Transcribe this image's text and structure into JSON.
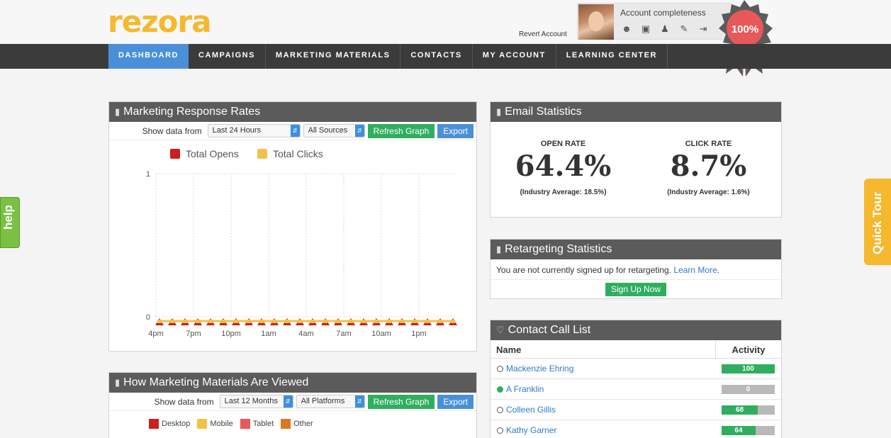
{
  "brand": {
    "logo": "rezora"
  },
  "header": {
    "revert_account": "Revert Account",
    "account_completeness": "Account completeness",
    "completeness_badge": "100%",
    "icons": [
      "user-icon",
      "id-card-icon",
      "people-icon",
      "pencil-icon",
      "import-icon"
    ]
  },
  "nav": {
    "items": [
      {
        "label": "DASHBOARD",
        "active": true
      },
      {
        "label": "CAMPAIGNS",
        "active": false
      },
      {
        "label": "MARKETING MATERIALS",
        "active": false
      },
      {
        "label": "CONTACTS",
        "active": false
      },
      {
        "label": "MY ACCOUNT",
        "active": false
      },
      {
        "label": "LEARNING CENTER",
        "active": false
      }
    ]
  },
  "response_rates": {
    "title": "Marketing Response Rates",
    "show_label": "Show data from",
    "time_value": "Last 24 Hours",
    "source_value": "All Sources",
    "refresh_label": "Refresh Graph",
    "export_label": "Export",
    "legend": [
      {
        "label": "Total Opens",
        "color": "#cc1f1f"
      },
      {
        "label": "Total Clicks",
        "color": "#f5c04a"
      }
    ]
  },
  "chart_data": {
    "type": "line",
    "title": "",
    "xlabel": "",
    "ylabel": "",
    "x": [
      "4pm",
      "7pm",
      "10pm",
      "1am",
      "4am",
      "7am",
      "10am",
      "1pm"
    ],
    "yticks": [
      "1",
      "0"
    ],
    "ylim": [
      0,
      1
    ],
    "series": [
      {
        "name": "Total Opens",
        "color": "#cc1f1f",
        "values": [
          0,
          0,
          0,
          0,
          0,
          0,
          0,
          0,
          0,
          0,
          0,
          0,
          0,
          0,
          0,
          0,
          0,
          0,
          0,
          0,
          0,
          0,
          0,
          0
        ]
      },
      {
        "name": "Total Clicks",
        "color": "#f5c04a",
        "values": [
          0,
          0,
          0,
          0,
          0,
          0,
          0,
          0,
          0,
          0,
          0,
          0,
          0,
          0,
          0,
          0,
          0,
          0,
          0,
          0,
          0,
          0,
          0,
          0
        ]
      }
    ],
    "grid": true,
    "legend": "top"
  },
  "email_stats": {
    "title": "Email Statistics",
    "open_label": "OPEN RATE",
    "open_value": "64.4%",
    "open_avg": "(Industry Average: 18.5%)",
    "click_label": "CLICK RATE",
    "click_value": "8.7%",
    "click_avg": "(Industry Average: 1.6%)"
  },
  "retargeting": {
    "title": "Retargeting Statistics",
    "message": "You are not currently signed up for retargeting.",
    "learn_more": "Learn More",
    "period": ".",
    "signup_label": "Sign Up Now"
  },
  "call_list": {
    "title": "Contact Call List",
    "col_name": "Name",
    "col_activity": "Activity",
    "rows": [
      {
        "name": "Mackenzie Ehring",
        "activity": 100,
        "label": "100",
        "online": false
      },
      {
        "name": "A Franklin",
        "activity": 0,
        "label": "0",
        "online": true
      },
      {
        "name": "Colleen Gillis",
        "activity": 68,
        "label": "68",
        "online": false
      },
      {
        "name": "Kathy Garner",
        "activity": 64,
        "label": "64",
        "online": false
      }
    ]
  },
  "materials": {
    "title": "How Marketing Materials Are Viewed",
    "show_label": "Show data from",
    "time_value": "Last 12 Months",
    "platform_value": "All Platforms",
    "refresh_label": "Refresh Graph",
    "export_label": "Export",
    "legend": [
      {
        "label": "Desktop",
        "color": "#cc1f1f"
      },
      {
        "label": "Mobile",
        "color": "#f5c04a"
      },
      {
        "label": "Tablet",
        "color": "#e8575a"
      },
      {
        "label": "Other",
        "color": "#d97a1f"
      }
    ]
  },
  "side_tabs": {
    "help": "help",
    "quick_tour": "Quick Tour"
  }
}
